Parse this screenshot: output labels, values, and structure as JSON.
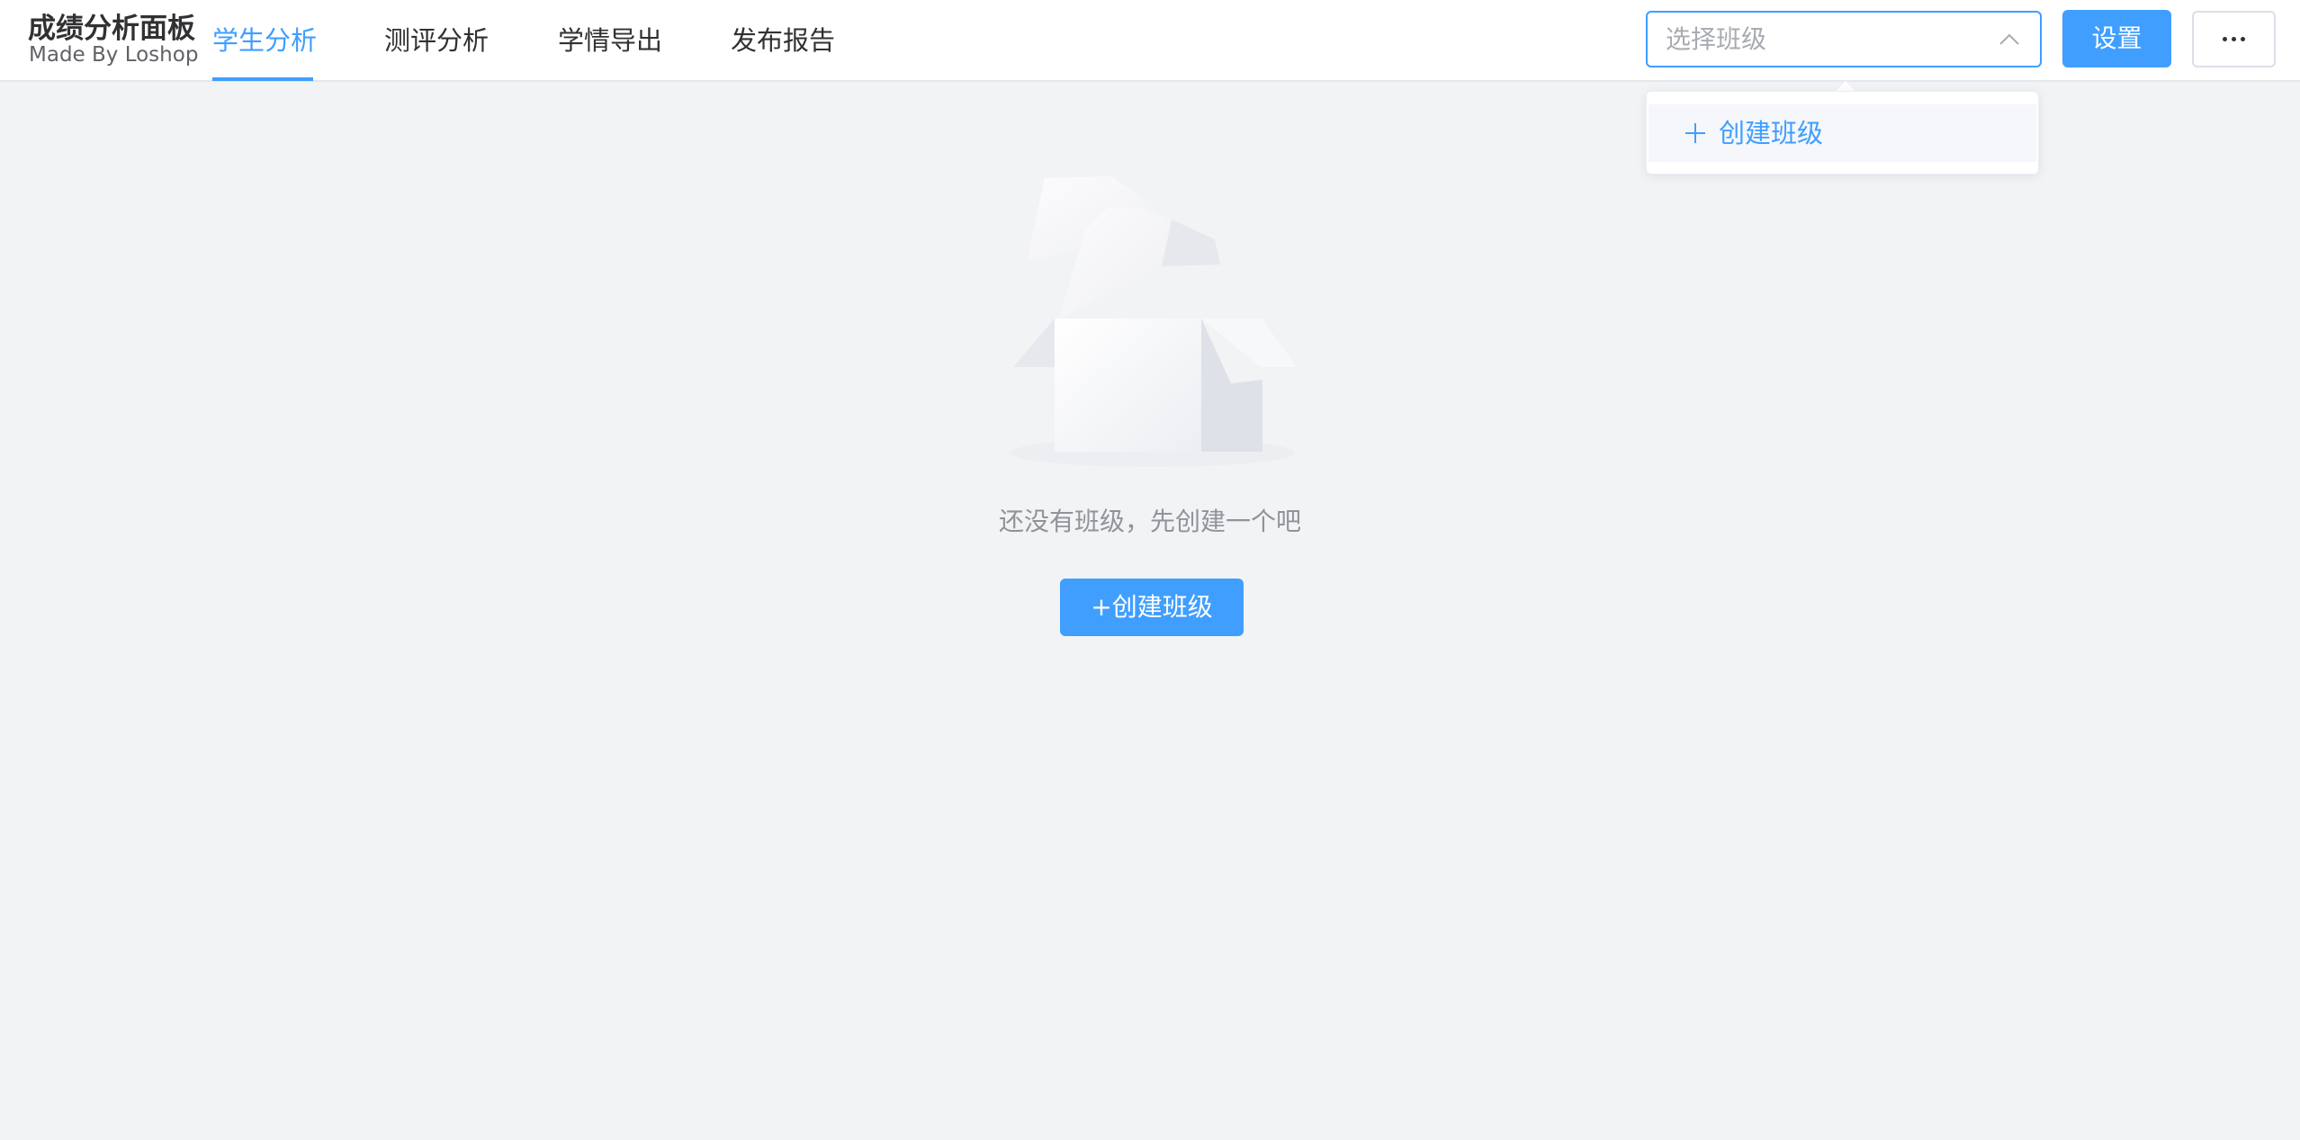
{
  "brand": {
    "title": "成绩分析面板",
    "subtitle": "Made By Loshop"
  },
  "nav": {
    "tabs": [
      {
        "label": "学生分析",
        "active": true
      },
      {
        "label": "测评分析",
        "active": false
      },
      {
        "label": "学情导出",
        "active": false
      },
      {
        "label": "发布报告",
        "active": false
      }
    ]
  },
  "class_select": {
    "placeholder": "选择班级",
    "value": ""
  },
  "dropdown": {
    "items": [
      {
        "label": "创建班级",
        "icon": "plus-icon"
      }
    ]
  },
  "header_actions": {
    "settings_label": "设置",
    "more_icon": "ellipsis-icon"
  },
  "empty_state": {
    "illustration": "empty-box-icon",
    "message": "还没有班级，先创建一个吧",
    "create_button_label": "+创建班级"
  },
  "colors": {
    "accent": "#409eff",
    "background": "#f2f3f5",
    "text_primary": "#303133",
    "text_secondary": "#909399"
  }
}
